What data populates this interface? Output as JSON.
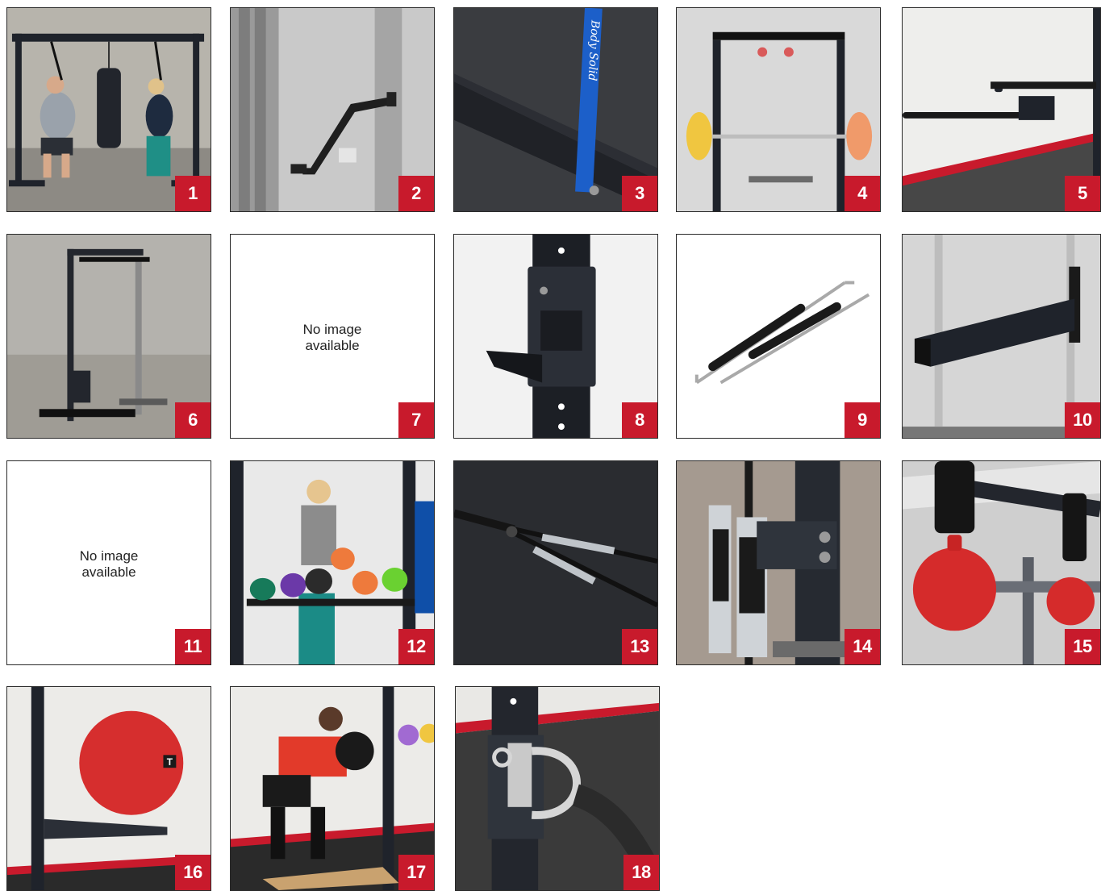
{
  "tiles": [
    {
      "badge": "1",
      "scene": "two-people-pulldown-straps"
    },
    {
      "badge": "2",
      "scene": "angled-rack-attachment"
    },
    {
      "badge": "3",
      "scene": "strap-anchor-on-base"
    },
    {
      "badge": "4",
      "scene": "pull-up-bar-with-pegs"
    },
    {
      "badge": "5",
      "scene": "dip-handles"
    },
    {
      "badge": "6",
      "scene": "lat-pulldown-station"
    },
    {
      "badge": "7",
      "scene": "no-image"
    },
    {
      "badge": "8",
      "scene": "j-hook"
    },
    {
      "badge": "9",
      "scene": "safety-bars"
    },
    {
      "badge": "10",
      "scene": "spotter-arm"
    },
    {
      "badge": "11",
      "scene": "no-image"
    },
    {
      "badge": "12",
      "scene": "kettlebell-shelf"
    },
    {
      "badge": "13",
      "scene": "landmine-arms"
    },
    {
      "badge": "14",
      "scene": "bar-holder"
    },
    {
      "badge": "15",
      "scene": "grip-balls"
    },
    {
      "badge": "16",
      "scene": "ball-holder"
    },
    {
      "badge": "17",
      "scene": "squat-on-platform"
    },
    {
      "badge": "18",
      "scene": "rope-anchor"
    }
  ],
  "placeholder": {
    "text": "No image\navailable"
  },
  "labels": {
    "strap_brand": "Body Solid",
    "ball_logo": "T"
  },
  "colors": {
    "badge": "#c81a2c",
    "frame": "#1f232b",
    "accent_red": "#d52b2b"
  }
}
